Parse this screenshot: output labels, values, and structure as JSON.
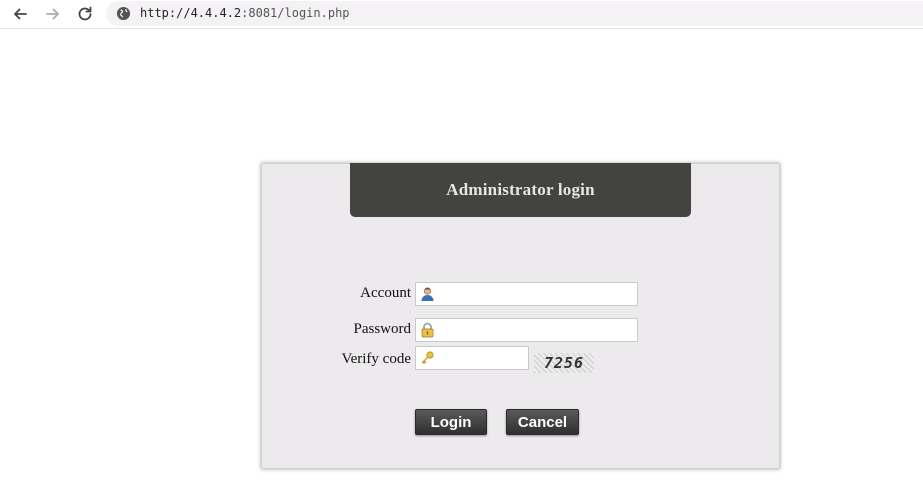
{
  "browser": {
    "url_host": "http://4.4.4.2",
    "url_rest": ":8081/login.php"
  },
  "login": {
    "title": "Administrator login",
    "account_label": "Account",
    "password_label": "Password",
    "verify_label": "Verify code",
    "account_value": "",
    "password_value": "",
    "verify_value": "",
    "captcha_text": "7256",
    "login_button": "Login",
    "cancel_button": "Cancel"
  }
}
